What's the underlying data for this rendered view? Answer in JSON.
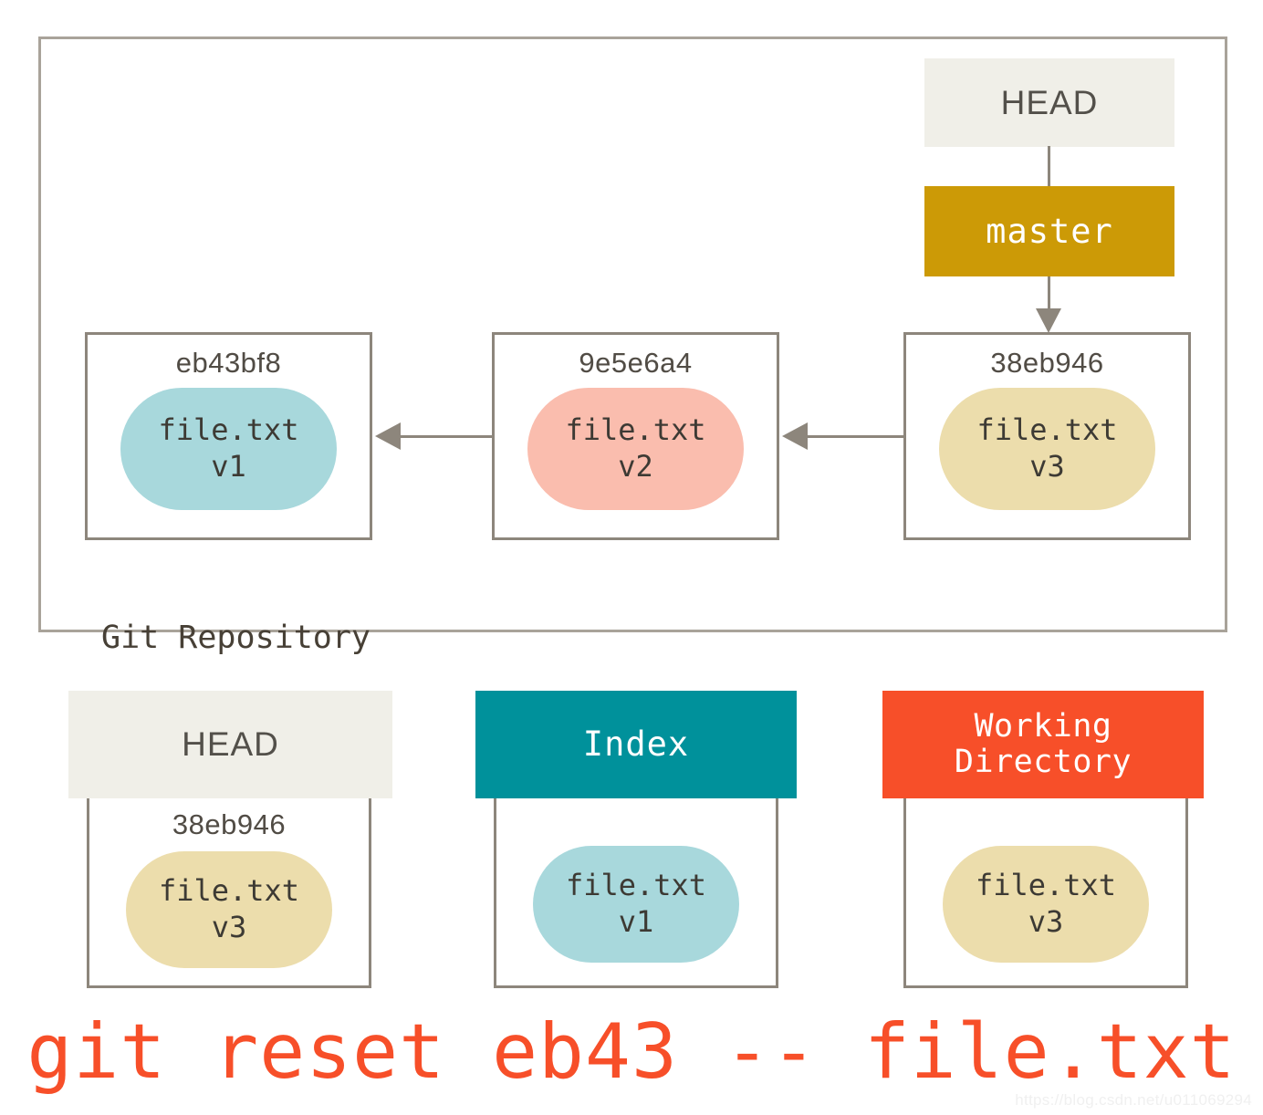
{
  "repository": {
    "label": "Git Repository",
    "head_pointer": {
      "label": "HEAD"
    },
    "branch_pointer": {
      "label": "master",
      "color": "#cc9a06"
    },
    "commits": [
      {
        "hash": "eb43bf8",
        "file_name": "file.txt",
        "version": "v1",
        "blob_color": "#a8d8dc"
      },
      {
        "hash": "9e5e6a4",
        "file_name": "file.txt",
        "version": "v2",
        "blob_color": "#fabdae"
      },
      {
        "hash": "38eb946",
        "file_name": "file.txt",
        "version": "v3",
        "blob_color": "#ecddac"
      }
    ]
  },
  "areas": [
    {
      "name": "HEAD",
      "header_color": "#f0efe8",
      "header_text_color": "#53504a",
      "hash": "38eb946",
      "file_name": "file.txt",
      "version": "v3",
      "blob_color": "#ecddac"
    },
    {
      "name": "Index",
      "header_color": "#00919b",
      "header_text_color": "#ffffff",
      "hash": "",
      "file_name": "file.txt",
      "version": "v1",
      "blob_color": "#a8d8dc"
    },
    {
      "name": "Working\nDirectory",
      "name_line1": "Working",
      "name_line2": "Directory",
      "header_color": "#f74f29",
      "header_text_color": "#ffffff",
      "hash": "",
      "file_name": "file.txt",
      "version": "v3",
      "blob_color": "#ecddac"
    }
  ],
  "caption": {
    "command": "git reset eb43 -- file.txt",
    "color": "#f74f29"
  },
  "watermark": {
    "text": "https://blog.csdn.net/u011069294"
  },
  "colors": {
    "frame_border": "#a9a39a",
    "box_border": "#8d867c",
    "arrow": "#8d867c",
    "background": "#ffffff"
  }
}
